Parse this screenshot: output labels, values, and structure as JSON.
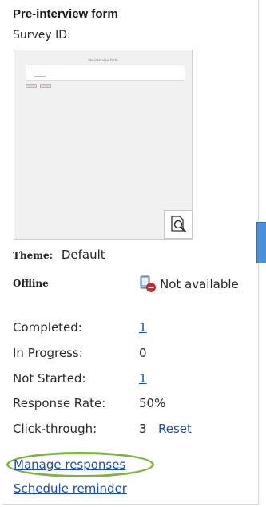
{
  "panel": {
    "title": "Pre-interview form",
    "survey_id_label": "Survey ID:",
    "preview": {
      "mini_title": "Pre-interview form"
    },
    "theme": {
      "label": "Theme:",
      "value": "Default"
    },
    "offline": {
      "label": "Offline",
      "value": "Not available",
      "icon": "offline-unavailable-icon"
    },
    "stats": {
      "completed": {
        "label": "Completed:",
        "value": "1"
      },
      "in_progress": {
        "label": "In Progress:",
        "value": "0"
      },
      "not_started": {
        "label": "Not Started:",
        "value": "1"
      },
      "response_rate": {
        "label": "Response Rate:",
        "value": "50%"
      },
      "click_through": {
        "label": "Click-through:",
        "value": "3",
        "reset_label": "Reset"
      }
    },
    "actions": {
      "manage": "Manage responses",
      "schedule": "Schedule reminder"
    }
  },
  "colors": {
    "link": "#1b4f9c",
    "highlight_ring": "#7cb342",
    "side_tab": "#4a90d9"
  }
}
